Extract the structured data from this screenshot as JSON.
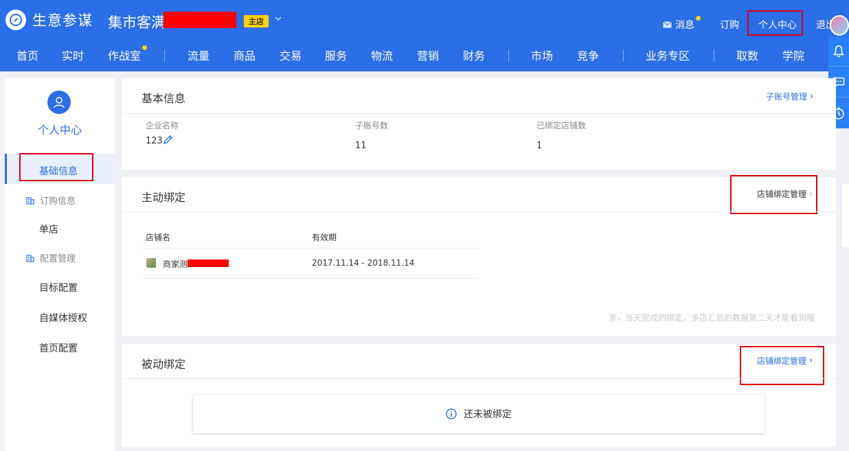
{
  "header": {
    "brand": "生意参谋",
    "shop_name": "集市客满",
    "shop_badge": "主店",
    "links": {
      "messages": "消息",
      "order": "订购",
      "personal_center": "个人中心",
      "logout": "退出"
    },
    "accent": "#2a6ee8",
    "badge_color": "#ffd200"
  },
  "nav": {
    "items": [
      "首页",
      "实时",
      "作战室",
      "流量",
      "商品",
      "交易",
      "服务",
      "物流",
      "营销",
      "财务",
      "市场",
      "竞争",
      "业务专区",
      "取数",
      "学院"
    ]
  },
  "float_bar": {
    "icons": [
      "bell-icon",
      "chat-icon",
      "timer-icon"
    ]
  },
  "sidebar": {
    "title": "个人中心",
    "items": {
      "basic_info": "基础信息",
      "order_info": "订购信息",
      "single_store": "单店",
      "config_mgmt": "配置管理",
      "target_config": "目标配置",
      "media_auth": "自媒体授权",
      "home_config": "首页配置"
    }
  },
  "basic_info": {
    "title": "基本信息",
    "link": "子账号管理",
    "fields": {
      "company_label": "企业名称",
      "company_value": "123",
      "subaccount_label": "子账号数",
      "subaccount_value": "11",
      "bound_label": "已绑定店铺数",
      "bound_value": "1"
    }
  },
  "active_binding": {
    "title": "主动绑定",
    "link": "店铺绑定管理",
    "columns": {
      "store": "店铺名",
      "validity": "有效期"
    },
    "rows": [
      {
        "store": "商家测",
        "validity": "2017.11.14 - 2018.11.14"
      }
    ],
    "hint": "亲，当天完成的绑定，多店汇总的数据第二天才能看到哦"
  },
  "passive_binding": {
    "title": "被动绑定",
    "link": "店铺绑定管理",
    "empty_text": "还未被绑定"
  }
}
